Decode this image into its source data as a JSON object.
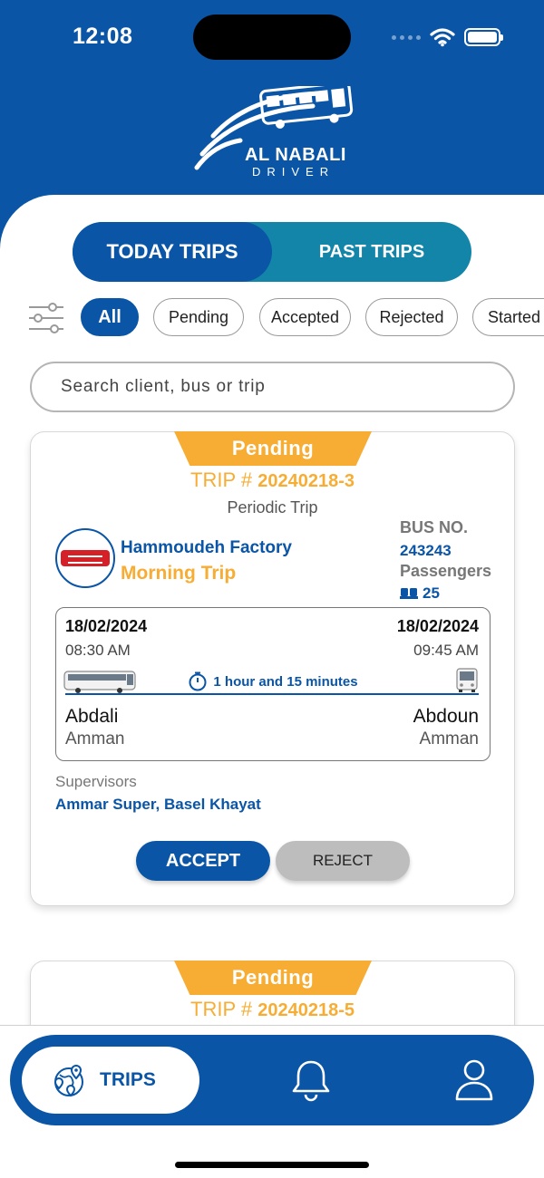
{
  "status_bar": {
    "time": "12:08"
  },
  "brand": {
    "name": "AL NABALI",
    "subtitle": "DRIVER"
  },
  "tabs": [
    {
      "label": "TODAY TRIPS",
      "active": true
    },
    {
      "label": "PAST TRIPS",
      "active": false
    }
  ],
  "filters": [
    {
      "label": "All",
      "active": true
    },
    {
      "label": "Pending",
      "active": false
    },
    {
      "label": "Accepted",
      "active": false
    },
    {
      "label": "Rejected",
      "active": false
    },
    {
      "label": "Started",
      "active": false
    }
  ],
  "search": {
    "placeholder": "Search client, bus or trip"
  },
  "trips": [
    {
      "status": "Pending",
      "trip_prefix": "TRIP #",
      "trip_number": "20240218-3",
      "trip_type": "Periodic Trip",
      "client": "Hammoudeh Factory",
      "title": "Morning Trip",
      "bus_label": "BUS NO.",
      "bus_number": "243243",
      "passengers_label": "Passengers",
      "passengers": "25",
      "departure": {
        "date": "18/02/2024",
        "time": "08:30 AM",
        "city": "Abdali",
        "region": "Amman"
      },
      "arrival": {
        "date": "18/02/2024",
        "time": "09:45 AM",
        "city": "Abdoun",
        "region": "Amman"
      },
      "duration": "1 hour and 15 minutes",
      "supervisors_label": "Supervisors",
      "supervisors": "Ammar Super, Basel Khayat",
      "accept_label": "ACCEPT",
      "reject_label": "REJECT"
    },
    {
      "status": "Pending",
      "trip_prefix": "TRIP #",
      "trip_number": "20240218-5"
    }
  ],
  "bottom_nav": {
    "trips_label": "TRIPS",
    "icons": [
      "map-pins-icon",
      "bell-icon",
      "user-icon"
    ]
  },
  "colors": {
    "primary": "#0a55a6",
    "teal": "#1285a8",
    "accent": "#f7ad34"
  }
}
